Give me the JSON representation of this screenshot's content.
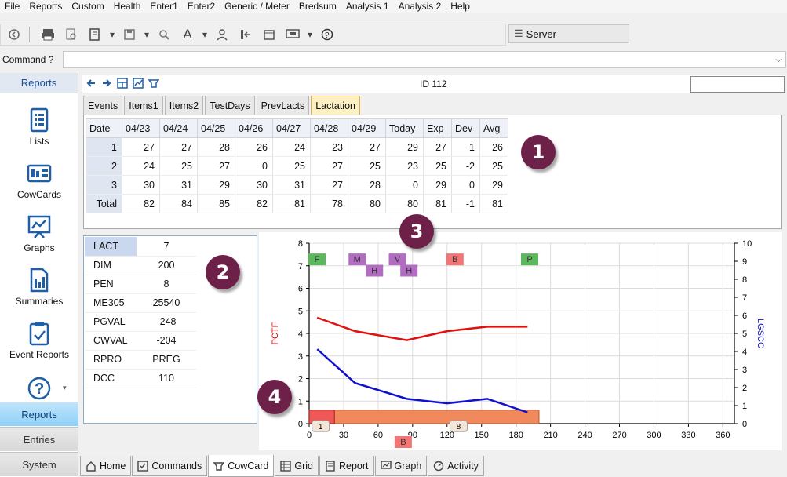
{
  "menu": [
    "File",
    "Reports",
    "Custom",
    "Health",
    "Enter1",
    "Enter2",
    "Generic / Meter",
    "Bredsum",
    "Analysis 1",
    "Analysis 2",
    "Help"
  ],
  "toolbar": {
    "icons": [
      "back-icon",
      "print-icon",
      "print-preview-icon",
      "report-icon",
      "save-icon",
      "search-icon",
      "font-icon",
      "user-icon",
      "import-icon",
      "calendar-icon",
      "screen-icon",
      "help-icon"
    ],
    "server_label": "Server"
  },
  "command": {
    "label": "Command ?",
    "value": ""
  },
  "left_nav": {
    "header": "Reports",
    "items": [
      {
        "label": "Lists",
        "icon": "list-icon"
      },
      {
        "label": "CowCards",
        "icon": "cowcard-icon"
      },
      {
        "label": "Graphs",
        "icon": "graph-icon"
      },
      {
        "label": "Summaries",
        "icon": "summary-icon"
      },
      {
        "label": "Event Reports",
        "icon": "event-report-icon"
      }
    ],
    "buttons": [
      {
        "label": "Reports",
        "active": true
      },
      {
        "label": "Entries",
        "active": false
      },
      {
        "label": "System",
        "active": false
      }
    ]
  },
  "main_header": {
    "title": "ID 112",
    "search_value": ""
  },
  "tabs": [
    {
      "label": "Events",
      "active": false
    },
    {
      "label": "Items1",
      "active": false
    },
    {
      "label": "Items2",
      "active": false
    },
    {
      "label": "TestDays",
      "active": false
    },
    {
      "label": "PrevLacts",
      "active": false
    },
    {
      "label": "Lactation",
      "active": true
    }
  ],
  "grid": {
    "columns": [
      "Date",
      "04/23",
      "04/24",
      "04/25",
      "04/26",
      "04/27",
      "04/28",
      "04/29",
      "Today",
      "Exp",
      "Dev",
      "Avg"
    ],
    "rows": [
      [
        "1",
        "27",
        "27",
        "28",
        "26",
        "24",
        "23",
        "27",
        "29",
        "27",
        "1",
        "26"
      ],
      [
        "2",
        "24",
        "25",
        "27",
        "0",
        "25",
        "27",
        "25",
        "23",
        "25",
        "-2",
        "25"
      ],
      [
        "3",
        "30",
        "31",
        "29",
        "30",
        "31",
        "27",
        "28",
        "0",
        "29",
        "0",
        "29"
      ],
      [
        "Total",
        "82",
        "84",
        "85",
        "82",
        "81",
        "78",
        "80",
        "80",
        "81",
        "-1",
        "81"
      ]
    ]
  },
  "markers": [
    "1",
    "2",
    "3",
    "4"
  ],
  "info": [
    {
      "key": "LACT",
      "value": "7"
    },
    {
      "key": "DIM",
      "value": "200"
    },
    {
      "key": "PEN",
      "value": "8"
    },
    {
      "key": "ME305",
      "value": "25540"
    },
    {
      "key": "PGVAL",
      "value": "-248"
    },
    {
      "key": "CWVAL",
      "value": "-204"
    },
    {
      "key": "RPRO",
      "value": "PREG"
    },
    {
      "key": "DCC",
      "value": "110"
    }
  ],
  "chart_data": {
    "type": "line",
    "ylabel": "PCTF",
    "y2label": "LGSCC",
    "xlim": [
      0,
      370
    ],
    "ylim": [
      0,
      8
    ],
    "y2lim": [
      0,
      10
    ],
    "x_ticks": [
      0,
      30,
      60,
      90,
      120,
      150,
      180,
      210,
      240,
      270,
      300,
      330,
      360
    ],
    "y_ticks": [
      0,
      1,
      2,
      3,
      4,
      5,
      6,
      7,
      8
    ],
    "y2_ticks": [
      0,
      1,
      2,
      3,
      4,
      5,
      6,
      7,
      8,
      9,
      10
    ],
    "series": [
      {
        "color": "#e01010",
        "axis": "left",
        "x": [
          7,
          40,
          85,
          120,
          155,
          190
        ],
        "y": [
          4.7,
          4.1,
          3.7,
          4.1,
          4.3,
          4.3
        ]
      },
      {
        "color": "#1010d0",
        "axis": "left",
        "x": [
          7,
          40,
          85,
          120,
          155,
          190
        ],
        "y": [
          3.3,
          1.8,
          1.1,
          0.9,
          1.1,
          0.5
        ]
      }
    ],
    "events": [
      {
        "label": "F",
        "x": 0,
        "y": 7.3,
        "color": "#5cb85c"
      },
      {
        "label": "M",
        "x": 35,
        "y": 7.3,
        "color": "#b26cc2"
      },
      {
        "label": "H",
        "x": 50,
        "y": 6.8,
        "color": "#b26cc2"
      },
      {
        "label": "V",
        "x": 70,
        "y": 7.3,
        "color": "#b26cc2"
      },
      {
        "label": "H",
        "x": 80,
        "y": 6.8,
        "color": "#b26cc2"
      },
      {
        "label": "B",
        "x": 120,
        "y": 7.3,
        "color": "#f27474"
      },
      {
        "label": "P",
        "x": 185,
        "y": 7.3,
        "color": "#5cb85c"
      },
      {
        "label": "B",
        "x": 75,
        "y": -0.8,
        "color": "#f27474"
      }
    ],
    "lactation_bar": {
      "start": 0,
      "end": 200,
      "color": "#f08a5d",
      "labels": [
        {
          "x": 10,
          "text": "1"
        },
        {
          "x": 130,
          "text": "8"
        }
      ]
    }
  }
}
